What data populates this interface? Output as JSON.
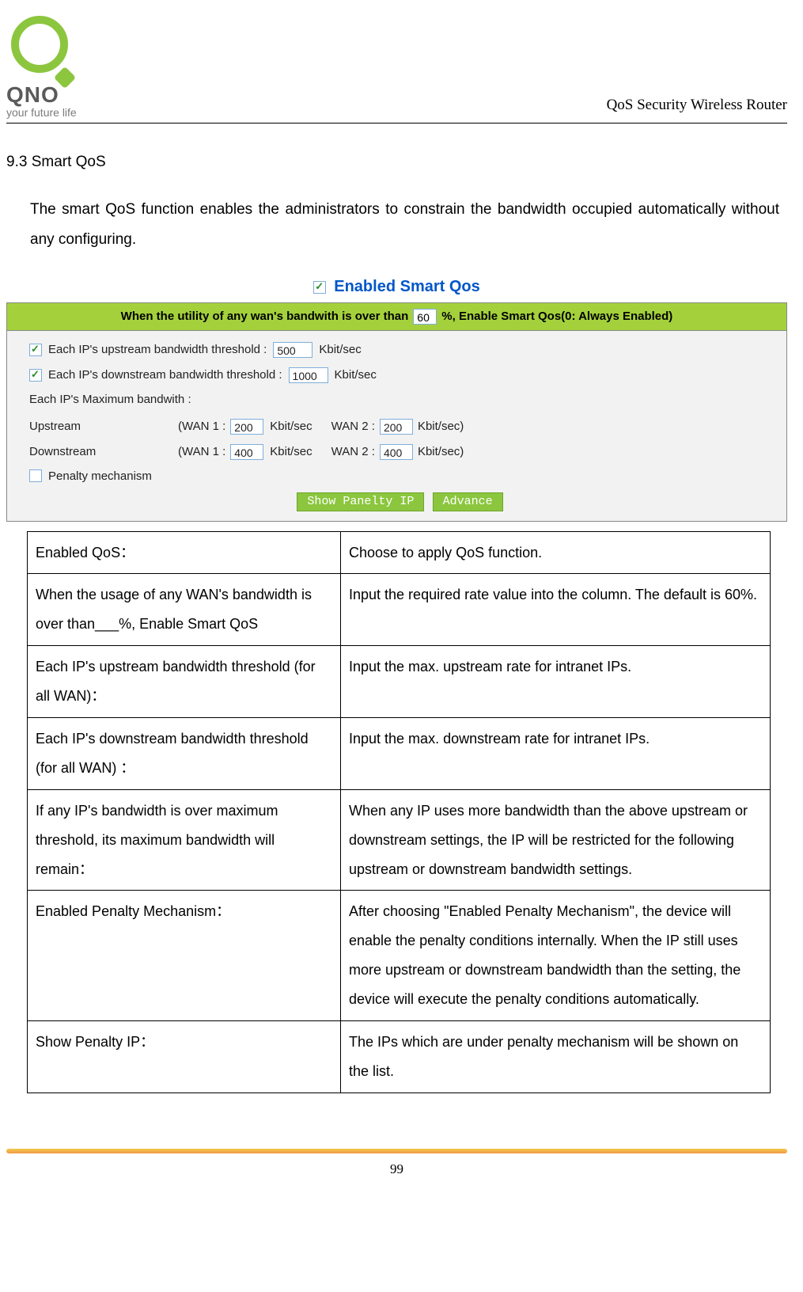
{
  "header": {
    "brand": "QNO",
    "tagline": "your future life",
    "doc_title": "QoS Security Wireless Router"
  },
  "section": {
    "number": "9.3",
    "title": "Smart QoS",
    "intro": "The smart QoS function enables the administrators to constrain the bandwidth occupied automatically without any configuring."
  },
  "screenshot": {
    "enabled_label": "Enabled  Smart Qos",
    "greenbar_prefix": "When the utility of any wan's bandwith is over than",
    "greenbar_value": "60",
    "greenbar_suffix": "%, Enable Smart Qos(0: Always Enabled)",
    "row_up_thresh_label": "Each IP's upstream bandwidth threshold :",
    "row_up_thresh_value": "500",
    "row_down_thresh_label": "Each IP's downstream bandwidth threshold :",
    "row_down_thresh_value": "1000",
    "unit": "Kbit/sec",
    "max_bw_label": "Each IP's Maximum bandwith :",
    "upstream_label": "Upstream",
    "downstream_label": "Downstream",
    "wan1_prefix": "(WAN 1 :",
    "wan2_prefix": "WAN 2 :",
    "close_paren_unit": "Kbit/sec)",
    "up_wan1": "200",
    "up_wan2": "200",
    "down_wan1": "400",
    "down_wan2": "400",
    "penalty_label": "Penalty mechanism",
    "btn_show": "Show Panelty IP",
    "btn_advance": "Advance"
  },
  "table": {
    "rows": [
      {
        "k": "Enabled QoS：",
        "v": "Choose to apply QoS function."
      },
      {
        "k": "When the usage of any WAN's bandwidth is over than___%, Enable Smart QoS",
        "v": "Input the required rate value into the column.    The default is 60%."
      },
      {
        "k": "Each IP's upstream bandwidth threshold (for all WAN)：",
        "v": "Input the max. upstream rate for intranet IPs."
      },
      {
        "k": "Each IP's downstream bandwidth threshold (for all WAN)  ：",
        "v": "Input the max. downstream rate for intranet IPs."
      },
      {
        "k": "If any IP's bandwidth is over maximum threshold, its maximum bandwidth will remain：",
        "v": "When any IP uses more bandwidth than the above upstream or downstream settings, the IP will be restricted for the following upstream or downstream bandwidth settings."
      },
      {
        "k": "Enabled Penalty Mechanism：",
        "v": "After choosing \"Enabled Penalty Mechanism\", the device will enable the penalty conditions internally. When the IP still uses more upstream or downstream bandwidth than the setting, the device will execute the penalty conditions automatically."
      },
      {
        "k": "Show Penalty IP：",
        "v": "The IPs which are under penalty mechanism will be shown on the list."
      }
    ]
  },
  "footer": {
    "page_number": "99"
  }
}
